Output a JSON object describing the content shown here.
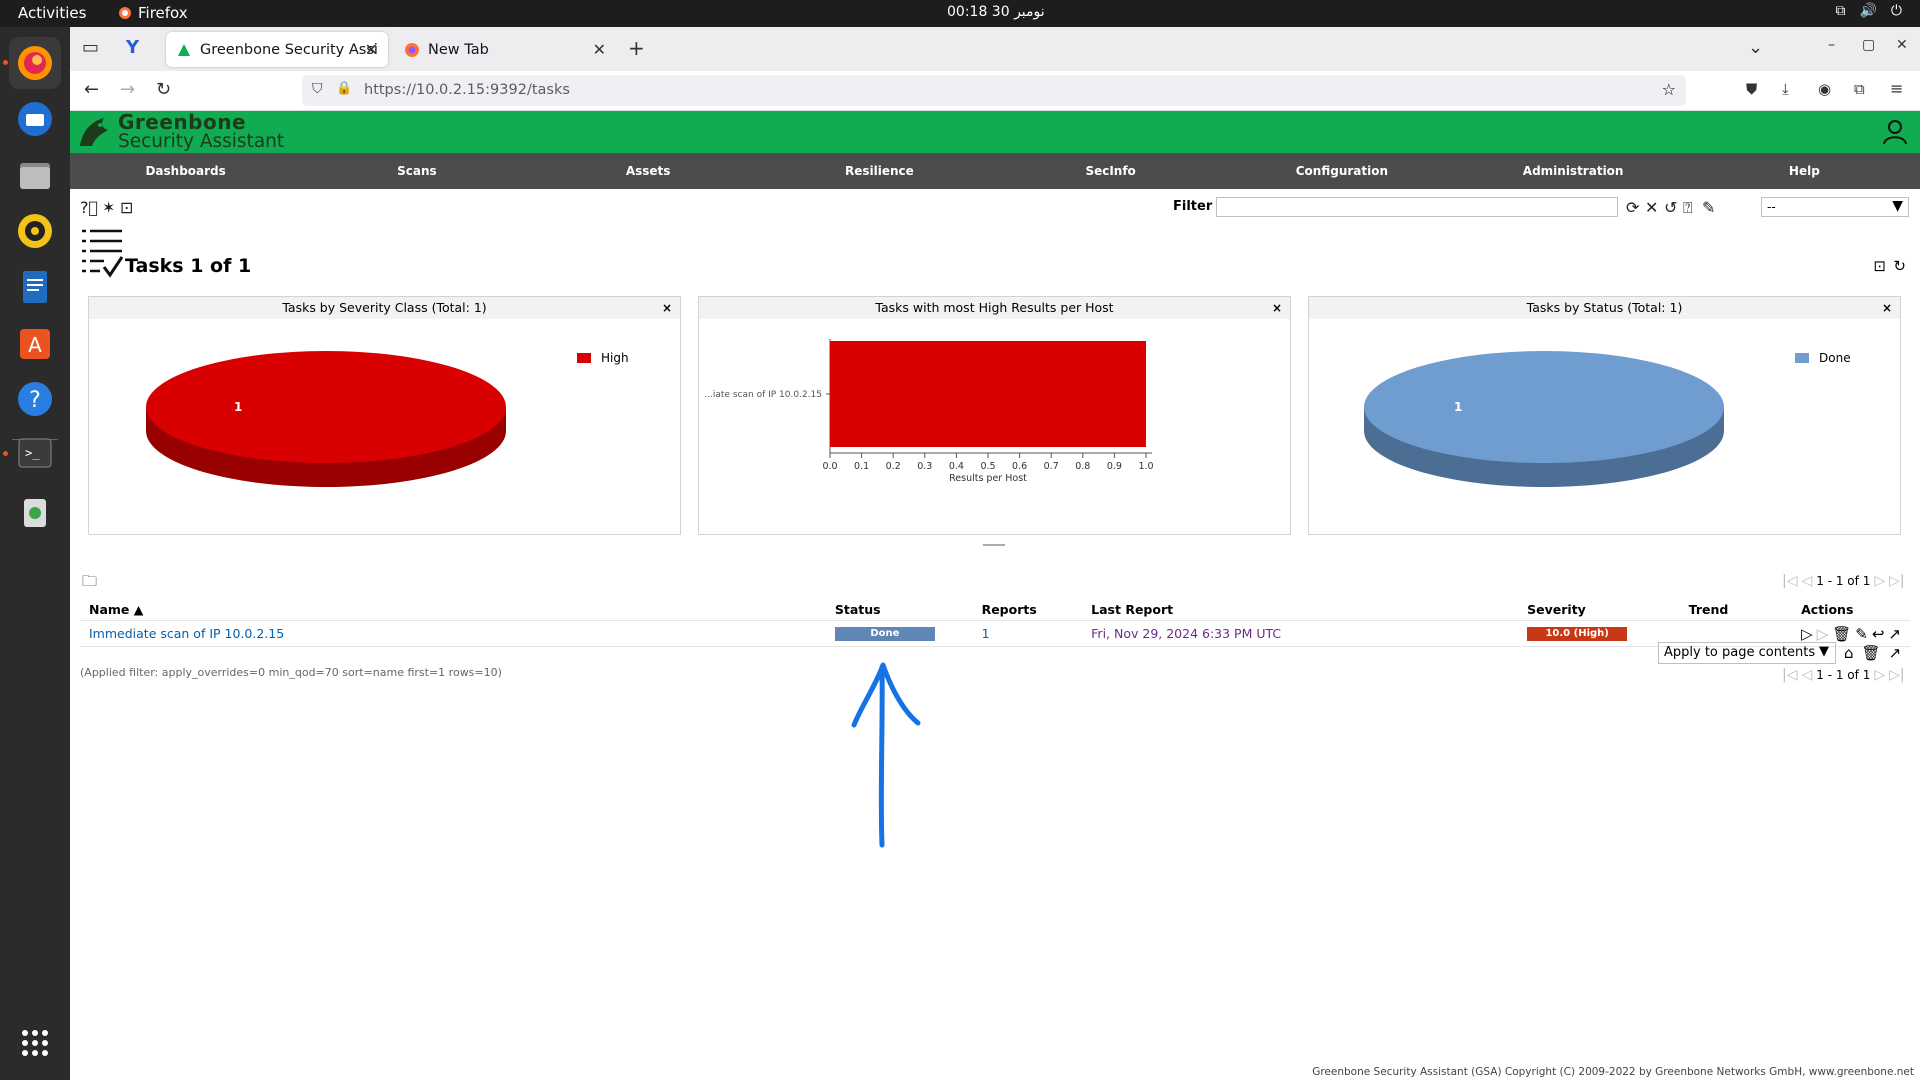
{
  "system": {
    "activities": "Activities",
    "app_name": "Firefox",
    "clock": "00:18  30 نومبر"
  },
  "browser": {
    "tabs": [
      {
        "title": "Greenbone Security Assi",
        "active": true
      },
      {
        "title": "New Tab",
        "active": false
      }
    ],
    "url_host": "https://10.0.2.15",
    "url_rest": ":9392/tasks"
  },
  "gsa": {
    "logo_line1": "Greenbone",
    "logo_line2": "Security Assistant",
    "menu": [
      "Dashboards",
      "Scans",
      "Assets",
      "Resilience",
      "SecInfo",
      "Configuration",
      "Administration",
      "Help"
    ],
    "filter_label": "Filter",
    "filter_value": "",
    "filter_select": "--",
    "section_title": "Tasks 1 of 1",
    "dashboards": [
      {
        "title": "Tasks by Severity Class (Total: 1)",
        "legend": "High",
        "slice_label": "1",
        "color": "#d80000"
      },
      {
        "title": "Tasks with most High Results per Host",
        "bar_label": "...iate scan of IP 10.0.2.15",
        "xlabel": "Results per Host"
      },
      {
        "title": "Tasks by Status (Total: 1)",
        "legend": "Done",
        "slice_label": "1",
        "color": "#709dd0"
      }
    ],
    "pager_top": "1 - 1 of 1",
    "pager_bottom": "1 - 1 of 1",
    "columns": [
      "Name ▲",
      "Status",
      "Reports",
      "Last Report",
      "Severity",
      "Trend",
      "Actions"
    ],
    "rows": [
      {
        "name": "Immediate scan of IP 10.0.2.15",
        "status": "Done",
        "reports": "1",
        "last_report": "Fri, Nov 29, 2024 6:33 PM UTC",
        "severity": "10.0 (High)",
        "trend": ""
      }
    ],
    "bulk_select": "Apply to page contents",
    "applied_filter": "(Applied filter: apply_overrides=0 min_qod=70 sort=name first=1 rows=10)",
    "footer": "Greenbone Security Assistant (GSA) Copyright (C) 2009-2022 by Greenbone Networks GmbH, www.greenbone.net"
  },
  "chart_data": {
    "type": "bar",
    "title": "Tasks with most High Results per Host",
    "categories": [
      "...iate scan of IP 10.0.2.15"
    ],
    "values": [
      1.0
    ],
    "xlabel": "Results per Host",
    "xlim": [
      0,
      1.0
    ],
    "xticks": [
      "0.0",
      "0.1",
      "0.2",
      "0.3",
      "0.4",
      "0.5",
      "0.6",
      "0.7",
      "0.8",
      "0.9",
      "1.0"
    ],
    "color": "#d80000"
  }
}
